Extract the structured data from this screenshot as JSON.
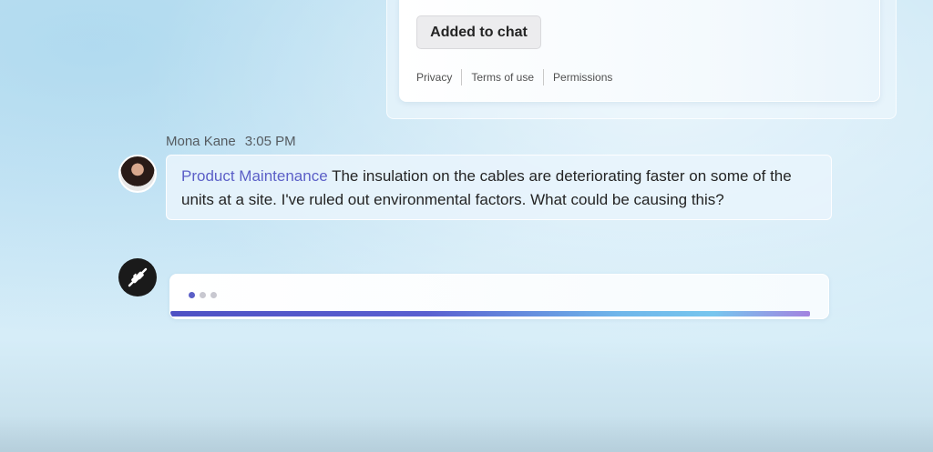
{
  "card": {
    "added_button": "Added to chat",
    "links": [
      "Privacy",
      "Terms of use",
      "Permissions"
    ]
  },
  "message": {
    "sender": "Mona Kane",
    "time": "3:05 PM",
    "mention": "Product Maintenance",
    "text": " The insulation on the cables are deteriorating faster on some of the units at a site.  I've ruled out environmental factors.  What could be causing this?"
  },
  "bot": {
    "icon": "plug-connect-icon",
    "typing_dots": 3,
    "progress": 1.0
  },
  "colors": {
    "mention": "#5b5fc7",
    "dot_active": "#5b5fc7",
    "progress_start": "#4f52c4",
    "progress_end": "#a383e0"
  }
}
